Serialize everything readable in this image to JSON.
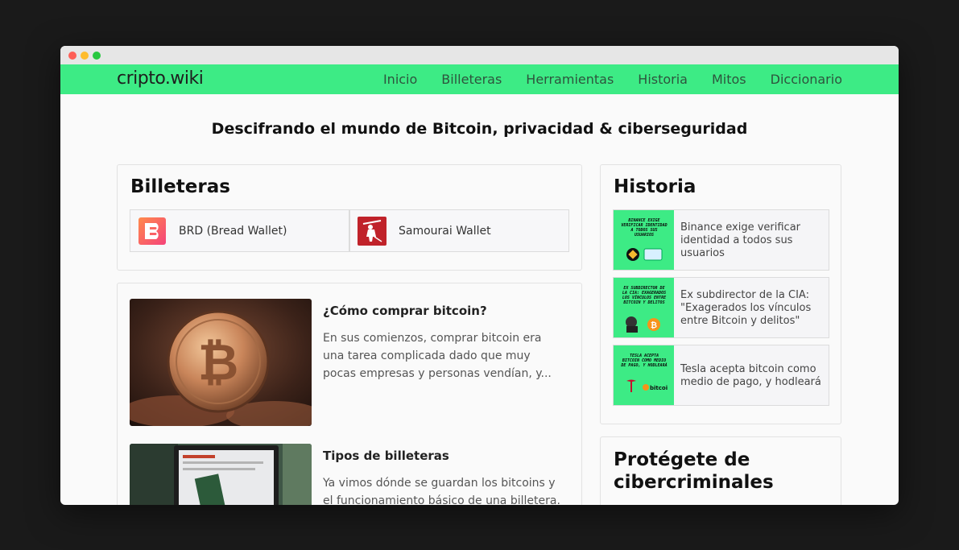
{
  "nav": {
    "brand": "cripto.wiki",
    "links": [
      "Inicio",
      "Billeteras",
      "Herramientas",
      "Historia",
      "Mitos",
      "Diccionario"
    ]
  },
  "tagline": "Descifrando el mundo de Bitcoin, privacidad & ciberseguridad",
  "wallets": {
    "title": "Billeteras",
    "items": [
      {
        "label": "BRD (Bread Wallet)",
        "icon": "brd-logo-icon"
      },
      {
        "label": "Samourai Wallet",
        "icon": "samourai-logo-icon"
      }
    ]
  },
  "articles": [
    {
      "title": "¿Cómo comprar bitcoin?",
      "excerpt": "En sus comienzos, comprar bitcoin era una tarea complicada dado que muy pocas empresas y personas vendían, y..."
    },
    {
      "title": "Tipos de billeteras",
      "excerpt": "Ya vimos dónde se guardan los bitcoins y el funcionamiento básico de una billetera."
    }
  ],
  "historia": {
    "title": "Historia",
    "items": [
      {
        "text": "Binance exige verificar identidad a todos sus usuarios",
        "thumb": "BINANCE EXIGE VERIFICAR IDENTIDAD A TODOS SUS USUARIOS"
      },
      {
        "text": "Ex subdirector de la CIA: \"Exagerados los vínculos entre Bitcoin y delitos\"",
        "thumb": "EX SUBDIRECTOR DE LA CIA: EXAGERADOS LOS VÍNCULOS ENTRE BITCOIN Y DELITOS"
      },
      {
        "text": "Tesla acepta bitcoin como medio de pago, y hodleará",
        "thumb": "TESLA ACEPTA BITCOIN COMO MEDIO DE PAGO, Y HODLEARÁ"
      }
    ]
  },
  "protect": {
    "title": "Protégete de cibercriminales"
  },
  "colors": {
    "accent": "#3deb85",
    "background": "#fafafa"
  }
}
